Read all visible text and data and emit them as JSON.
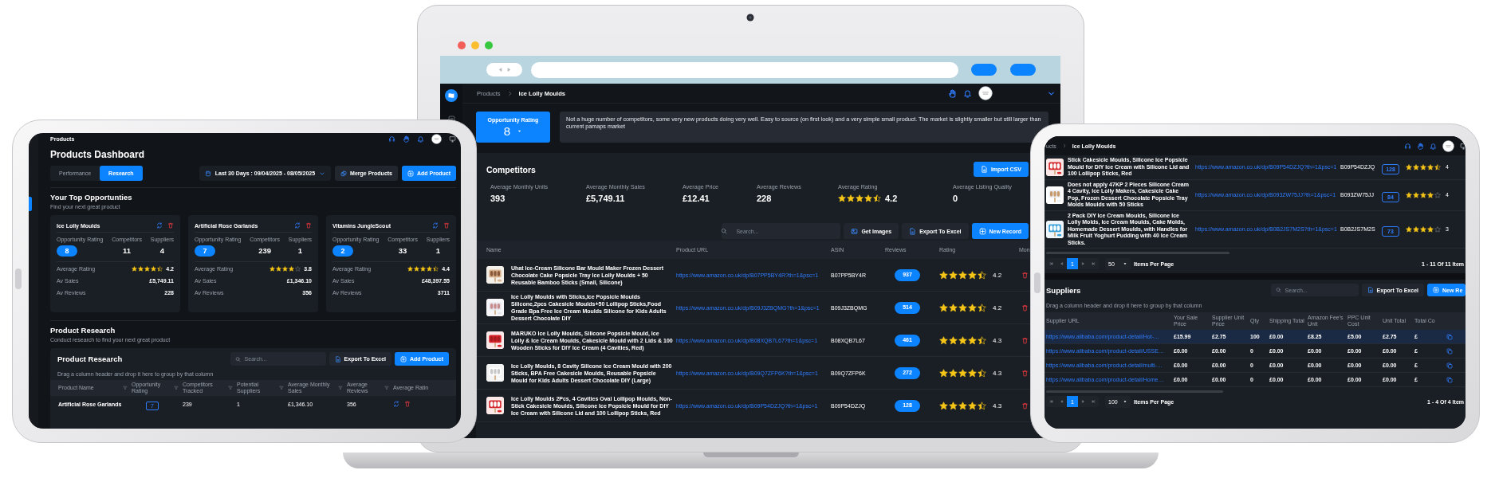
{
  "laptop": {
    "breadcrumb": [
      {
        "label": "Products",
        "current": false
      },
      {
        "label": "Ice Lolly Moulds",
        "current": true
      }
    ],
    "opportunity": {
      "label": "Opportunity Rating",
      "value": "8"
    },
    "notes": "Not a huge number of competitors, some very new products doing very well. Easy to source (on first look) and a very simple small product. The market is slightly smaller but still larger than current pamaps market",
    "competitors": {
      "title": "Competitors",
      "import_button": {
        "kind": "import",
        "label": "Import CSV"
      },
      "stats": [
        {
          "kind": "number",
          "label": "Average Monthly Units",
          "value": "393"
        },
        {
          "kind": "number",
          "label": "Average Monthly Sales",
          "value": "£5,749.11"
        },
        {
          "kind": "number",
          "label": "Average Price",
          "value": "£12.41"
        },
        {
          "kind": "number",
          "label": "Average Reviews",
          "value": "228"
        },
        {
          "kind": "rating",
          "label": "Average Rating",
          "stars": 4.5,
          "value": "4.2"
        },
        {
          "kind": "number",
          "label": "Average Listing Quality",
          "value": "0"
        }
      ]
    },
    "search_placeholder": "Search...",
    "buttons": [
      {
        "kind": "images",
        "label": "Get Images"
      },
      {
        "kind": "export",
        "label": "Export To Excel"
      },
      {
        "kind": "new",
        "label": "New Record"
      }
    ],
    "columns": [
      "Name",
      "Product URL",
      "ASIN",
      "Reviews",
      "Rating",
      "Mon"
    ],
    "rows": [
      {
        "name": "Uhat Ice-Cream Silicone Bar Mould Maker Frozen Dessert Chocolate Cake Popsicle Tray Ice Lolly Moulds + 50 Reusable Bamboo Sticks (Small, Silicone)",
        "url": "https://www.amazon.co.uk/dp/B07PP5BY4R?th=1&psc=1",
        "asin": "B07PP5BY4R",
        "reviews": "937",
        "stars": 4.5,
        "rating": "4.2"
      },
      {
        "name": "Ice Lolly Moulds with Sticks,Ice Popsicle Moulds Silicone,2pcs Cakesicle Moulds+50 Lollipop Sticks,Food Grade Bpa Free Ice Cream Moulds Silicone for Kids Adults Dessert Chocolate DIY",
        "url": "https://www.amazon.co.uk/dp/B09J3ZBQMG?th=1&psc=1",
        "asin": "B09J3ZBQMG",
        "reviews": "514",
        "stars": 4.5,
        "rating": "4.2"
      },
      {
        "name": "MARUKO Ice Lolly Moulds, Silicone Popsicle Mould, Ice Lolly & Ice Cream Moulds, Cakesicle Mould with 2 Lids & 100 Wooden Sticks for DIY Ice Cream (4 Cavities, Red)",
        "url": "https://www.amazon.co.uk/dp/B08XQB7L67?th=1&psc=1",
        "asin": "B08XQB7L67",
        "reviews": "461",
        "stars": 4.5,
        "rating": "4.3"
      },
      {
        "name": "Ice Lolly Moulds, 8 Cavity Silicone Ice Cream Mould with 200 Sticks, BPA Free Cakesicle Moulds, Reusable Popsicle Mould for Kids Adults Dessert Chocolate DIY (Large)",
        "url": "https://www.amazon.co.uk/dp/B09Q7ZFP6K?th=1&psc=1",
        "asin": "B09Q7ZFP6K",
        "reviews": "272",
        "stars": 4.5,
        "rating": "4.3"
      },
      {
        "name": "Ice Lolly Moulds 2Pcs, 4 Cavities Oval Lollipop Moulds, Non-Stick Cakesicle Moulds, Silicone Ice Popsicle Mould for DIY Ice Cream with Silicone Lid and 100 Lollipop Sticks, Red",
        "url": "https://www.amazon.co.uk/dp/B09P54DZJQ?th=1&psc=1",
        "asin": "B09P54DZJQ",
        "reviews": "128",
        "stars": 4.5,
        "rating": "4.3"
      }
    ]
  },
  "left_tablet": {
    "breadcrumb": "Products",
    "title": "Products Dashboard",
    "tabs": [
      {
        "label": "Performance",
        "selected": false
      },
      {
        "label": "Research",
        "selected": true
      }
    ],
    "date_range": "Last 30 Days : 09/04/2025 - 08/05/2025",
    "buttons": [
      {
        "kind": "merge",
        "label": "Merge Products"
      },
      {
        "kind": "add",
        "label": "Add Product"
      }
    ],
    "opportunities": {
      "title": "Your Top Opportunties",
      "subtitle": "Find your next great product",
      "cards": [
        {
          "name": "Ice Lolly Moulds",
          "opportunity_label": "Opportunity Rating",
          "opportunity": "8",
          "competitors_label": "Competitors",
          "competitors": "11",
          "suppliers_label": "Suppliers",
          "suppliers": "4",
          "rating_label": "Average Rating",
          "stars": 4.5,
          "rating": "4.2",
          "sales_label": "Av Sales",
          "sales": "£5,749.11",
          "reviews_label": "Av Reviews",
          "reviews": "228"
        },
        {
          "name": "Artificial Rose Garlands",
          "opportunity_label": "Opportunity Rating",
          "opportunity": "7",
          "competitors_label": "Competitors",
          "competitors": "239",
          "suppliers_label": "Suppliers",
          "suppliers": "1",
          "rating_label": "Average Rating",
          "stars": 4,
          "rating": "3.8",
          "sales_label": "Av Sales",
          "sales": "£1,346.10",
          "reviews_label": "Av Reviews",
          "reviews": "356"
        },
        {
          "name": "Vitamins JungleScout",
          "opportunity_label": "Opportunity Rating",
          "opportunity": "2",
          "competitors_label": "Competitors",
          "competitors": "33",
          "suppliers_label": "Suppliers",
          "suppliers": "1",
          "rating_label": "Average Rating",
          "stars": 4.5,
          "rating": "4.4",
          "sales_label": "Av Sales",
          "sales": "£48,397.55",
          "reviews_label": "Av Reviews",
          "reviews": "3711"
        }
      ]
    },
    "research": {
      "title": "Product Research",
      "subtitle": "Conduct research to find your next great product"
    },
    "table": {
      "title": "Product Research",
      "search_placeholder": "Search...",
      "buttons": [
        {
          "kind": "export",
          "label": "Export To Excel"
        },
        {
          "kind": "add",
          "label": "Add Product"
        }
      ],
      "group_hint": "Drag a column header and drop it here to group by that column",
      "columns": [
        "Product Name",
        "Opportunity Rating",
        "Competitors Tracked",
        "Potential Suppliers",
        "Average Monthly Sales",
        "Average Reviews",
        "Average Ratin"
      ],
      "rows": [
        {
          "name": "Artificial Rose Garlands",
          "opportunity": "7",
          "competitors": "239",
          "suppliers": "1",
          "sales": "£1,346.10",
          "reviews": "356"
        }
      ]
    }
  },
  "right_tablet": {
    "breadcrumb": [
      {
        "label": "ucts",
        "current": false
      },
      {
        "label": "Ice Lolly Moulds",
        "current": true
      }
    ],
    "rows": [
      {
        "name": "Stick Cakesicle Moulds, Silicone Ice Popsicle Mould for DIY Ice Cream with Silicone Lid and 100 Lollipop Sticks, Red",
        "url": "https://www.amazon.co.uk/dp/B09P54DZJQ?th=1&psc=1",
        "asin": "B09P54DZJQ",
        "reviews": "128",
        "stars": 4.5,
        "rating": "4"
      },
      {
        "name": "Does not apply 47KP 2 Pieces Silicone Cream 4 Cavity, Ice Lolly Makers, Cakesicle Cake Pop, Frozen Dessert Chocolate Popsicle Tray Molds Moulds with 50 Sticks",
        "url": "https://www.amazon.co.uk/dp/B093ZW75JJ?th=1&psc=1",
        "asin": "B093ZW75JJ",
        "reviews": "84",
        "stars": 4,
        "rating": "4"
      },
      {
        "name": "2 Pack DIY Ice Cream Moulds, Silicone Ice Lolly Molds, Ice Cream Moulds, Cake Molds, Homemade Dessert Moulds, with Handles for Milk Fruit Yoghurt Pudding with 40 Ice Cream Sticks.",
        "url": "https://www.amazon.co.uk/dp/B0B2JS7M2S?th=1&psc=1",
        "asin": "B0B2JS7M2S",
        "reviews": "73",
        "stars": 4,
        "rating": "3"
      }
    ],
    "pager": {
      "pages": [
        {
          "label": "1",
          "selected": true
        }
      ],
      "page_size": "50",
      "per_page_label": "Items Per Page",
      "count": "1 - 11 Of 11 Item"
    },
    "suppliers": {
      "title": "Suppliers",
      "search_placeholder": "Search...",
      "buttons": [
        {
          "kind": "export",
          "label": "Export To Excel"
        },
        {
          "kind": "new",
          "label": "New Re"
        }
      ],
      "group_hint": "Drag a column header and drop it here to group by that column",
      "columns": [
        "Supplier URL",
        "Your Sale Price",
        "Supplier Unit Price",
        "Qty",
        "Shipping Total",
        "Amazon Fee's Unit",
        "PPC Unit Cost",
        "Unit Total",
        "Total Co"
      ],
      "rows": [
        {
          "selected": true,
          "cells": [
            "https://www.alibaba.com/product-detail/Hot-…",
            "£15.99",
            "£2.75",
            "100",
            "£0.00",
            "£8.25",
            "£5.00",
            "£2.75",
            "£"
          ]
        },
        {
          "selected": false,
          "cells": [
            "https://www.alibaba.com/product-detail/USSE…",
            "£0.00",
            "£0.00",
            "0",
            "£0.00",
            "£0.00",
            "£0.00",
            "£0.00",
            "£"
          ]
        },
        {
          "selected": false,
          "cells": [
            "https://www.alibaba.com/product-detail/multi-…",
            "£0.00",
            "£0.00",
            "0",
            "£0.00",
            "£0.00",
            "£0.00",
            "£0.00",
            "£"
          ]
        },
        {
          "selected": false,
          "cells": [
            "https://www.alibaba.com/product-detail/Home…",
            "£0.00",
            "£0.00",
            "0",
            "£0.00",
            "£0.00",
            "£0.00",
            "£0.00",
            "£"
          ]
        }
      ],
      "pager": {
        "pages": [
          {
            "label": "1",
            "selected": true
          }
        ],
        "page_size": "100",
        "per_page_label": "Items Per Page",
        "count": "1 - 4 Of 4 Item"
      }
    }
  }
}
